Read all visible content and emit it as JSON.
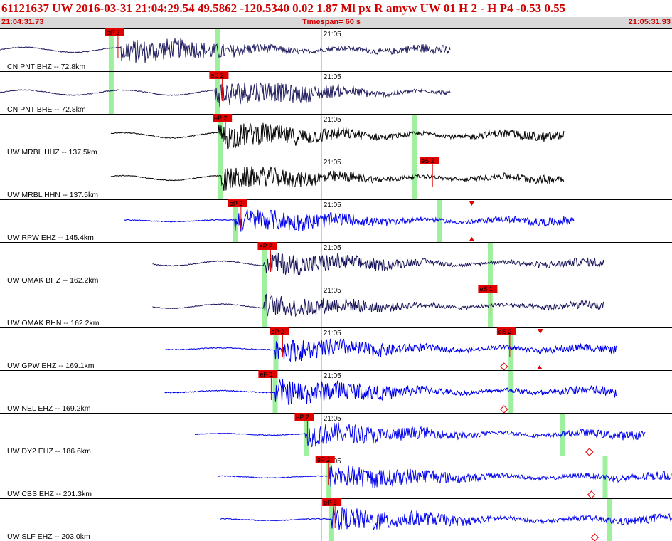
{
  "header": {
    "title": "61121637 UW 2016-03-31 21:04:29.54   49.5862 -120.5340   0.02  1.87 Ml  px  R amyw     UW 01  H   2  -  H P4   -0.53  0.55",
    "start_time": "21:04:31.73",
    "timespan": "Timespan=  60 s",
    "end_time": "21:05:31.93"
  },
  "colors": {
    "title": "#d00000",
    "pick_box": "#e00000",
    "window_band": "#9ef09e",
    "trace_navy": "#1e1a5e",
    "trace_black": "#000000",
    "trace_blue": "#0000ee"
  },
  "chart_data": {
    "type": "line",
    "title": "",
    "time_tick_label": "21:05",
    "traces": [
      {
        "label": "CN PNT BHZ -- 72.8km",
        "color": "navy",
        "start": 0,
        "end": 0.67,
        "onset": 0.18,
        "amp": 0.55,
        "picks": [
          {
            "text": "eP 2",
            "x": 0.165
          }
        ],
        "green": [
          0.165,
          0.323
        ],
        "triangles": []
      },
      {
        "label": "CN PNT BHE -- 72.8km",
        "color": "navy",
        "start": 0,
        "end": 0.67,
        "onset": 0.32,
        "amp": 0.55,
        "picks": [
          {
            "text": "eS 2",
            "x": 0.32
          }
        ],
        "green": [
          0.165,
          0.323
        ],
        "triangles": []
      },
      {
        "label": "UW MRBL HHZ -- 137.5km",
        "color": "black",
        "start": 0.165,
        "end": 0.84,
        "onset": 0.325,
        "amp": 0.55,
        "picks": [
          {
            "text": "eP 2",
            "x": 0.325
          }
        ],
        "green": [
          0.328,
          0.617
        ],
        "triangles": []
      },
      {
        "label": "UW MRBL HHN -- 137.5km",
        "color": "black",
        "start": 0.165,
        "end": 0.84,
        "onset": 0.33,
        "amp": 0.5,
        "picks": [
          {
            "text": "eS 2",
            "x": 0.633
          }
        ],
        "green": [
          0.328,
          0.617
        ],
        "triangles": []
      },
      {
        "label": "UW RPW EHZ -- 145.4km",
        "color": "blue",
        "start": 0.185,
        "end": 0.855,
        "onset": 0.35,
        "amp": 0.5,
        "picks": [
          {
            "text": "eP 2",
            "x": 0.348
          }
        ],
        "green": [
          0.35,
          0.654
        ],
        "triangles": [
          {
            "x": 0.702,
            "dir": "down"
          },
          {
            "x": 0.702,
            "dir": "up"
          }
        ]
      },
      {
        "label": "UW OMAK BHZ -- 162.2km",
        "color": "navy",
        "start": 0.227,
        "end": 0.9,
        "onset": 0.393,
        "amp": 0.5,
        "picks": [
          {
            "text": "eP 2",
            "x": 0.392
          }
        ],
        "green": [
          0.393,
          0.729
        ],
        "triangles": []
      },
      {
        "label": "UW OMAK BHN -- 162.2km",
        "color": "navy",
        "start": 0.227,
        "end": 0.9,
        "onset": 0.393,
        "amp": 0.45,
        "picks": [
          {
            "text": "eS 1",
            "x": 0.72
          }
        ],
        "green": [
          0.393,
          0.729
        ],
        "triangles": []
      },
      {
        "label": "UW GPW EHZ -- 169.1km",
        "color": "blue",
        "start": 0.245,
        "end": 0.917,
        "onset": 0.41,
        "amp": 0.5,
        "picks": [
          {
            "text": "eP 2",
            "x": 0.41
          },
          {
            "text": "eS 2",
            "x": 0.748
          }
        ],
        "green": [
          0.41,
          0.76
        ],
        "triangles": [
          {
            "x": 0.804,
            "dir": "down"
          },
          {
            "x": 0.75,
            "dir": "hollow"
          },
          {
            "x": 0.803,
            "dir": "up"
          }
        ]
      },
      {
        "label": "UW NEL EHZ -- 169.2km",
        "color": "blue",
        "start": 0.245,
        "end": 0.917,
        "onset": 0.41,
        "amp": 0.55,
        "picks": [
          {
            "text": "eP 1",
            "x": 0.393
          }
        ],
        "green": [
          0.409,
          0.76
        ],
        "triangles": [
          {
            "x": 0.75,
            "dir": "hollow"
          }
        ]
      },
      {
        "label": "UW DY2 EHZ -- 186.6km",
        "color": "blue",
        "start": 0.29,
        "end": 0.96,
        "onset": 0.455,
        "amp": 0.5,
        "picks": [
          {
            "text": "eP 2",
            "x": 0.447
          }
        ],
        "green": [
          0.455,
          0.837
        ],
        "triangles": [
          {
            "x": 0.877,
            "dir": "hollow"
          }
        ]
      },
      {
        "label": "UW CBS EHZ -- 201.3km",
        "color": "blue",
        "start": 0.325,
        "end": 1.0,
        "onset": 0.49,
        "amp": 0.5,
        "picks": [
          {
            "text": "eP 2",
            "x": 0.478
          }
        ],
        "green": [
          0.489,
          0.9
        ],
        "triangles": [
          {
            "x": 0.88,
            "dir": "hollow"
          }
        ]
      },
      {
        "label": "UW SLF EHZ -- 203.0km",
        "color": "blue",
        "start": 0.328,
        "end": 1.0,
        "onset": 0.494,
        "amp": 0.5,
        "picks": [
          {
            "text": "eP 3",
            "x": 0.488
          }
        ],
        "green": [
          0.492,
          0.906
        ],
        "triangles": [
          {
            "x": 0.885,
            "dir": "hollow"
          }
        ]
      }
    ]
  }
}
